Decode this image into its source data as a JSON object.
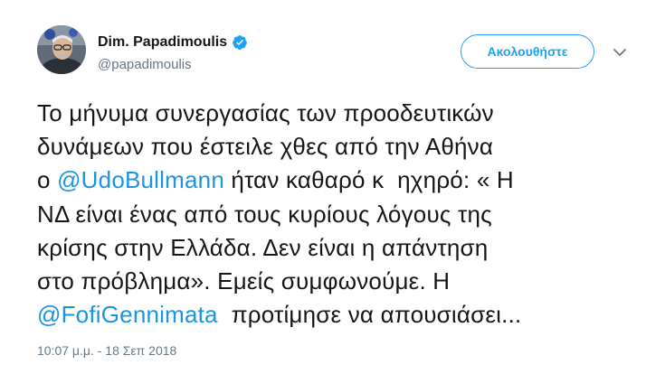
{
  "author": {
    "name": "Dim. Papadimoulis",
    "handle": "@papadimoulis",
    "verified": true
  },
  "follow_button": {
    "label": "Ακολουθήστε"
  },
  "menu": {
    "icon": "chevron-down-icon"
  },
  "tweet": {
    "line1": "Το μήνυμα συνεργασίας των προοδευτικών",
    "line2": "δυνάμεων που έστειλε χθες από την Αθήνα",
    "line3_prefix": "ο ",
    "mention1": "@UdoBullmann",
    "line3_suffix": " ήταν καθαρό κ  ηχηρό: « Η",
    "line4": "ΝΔ είναι ένας από τους κυρίους λόγους της",
    "line5": "κρίσης στην Ελλάδα. Δεν είναι η απάντηση",
    "line6": "στο πρόβλημα». Εμείς συμφωνούμε. Η",
    "mention2": "@FofiGennimata",
    "line7_suffix": "  προτίμησε να απουσιάσει..."
  },
  "timestamp": "10:07 μ.μ. - 18 Σεπ 2018",
  "colors": {
    "accent": "#1da1f2",
    "mention": "#1b95e0",
    "secondary_text": "#657786",
    "primary_text": "#14171a"
  }
}
